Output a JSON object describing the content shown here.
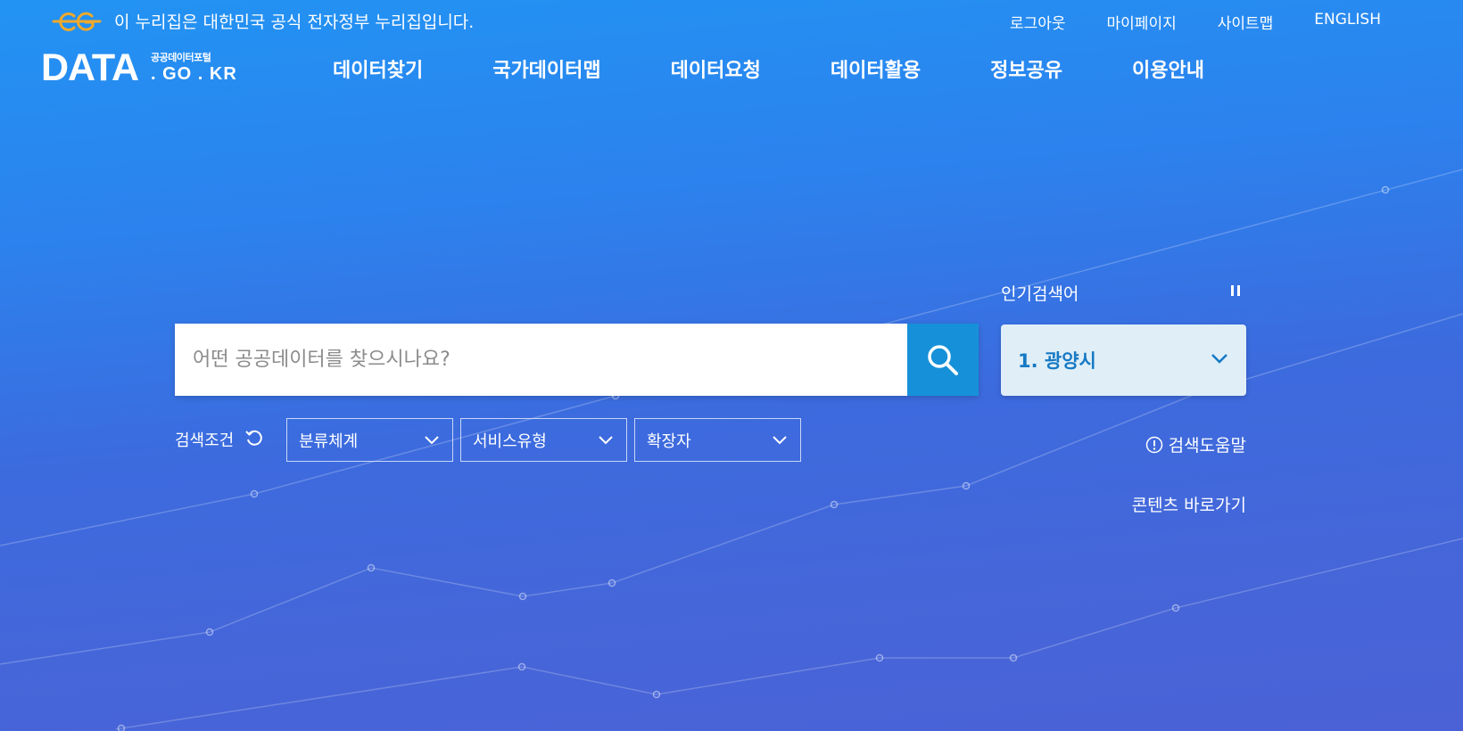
{
  "topbar": {
    "notice": "이 누리집은 대한민국 공식 전자정부 누리집입니다.",
    "links": [
      "로그아웃",
      "마이페이지",
      "사이트맵",
      "ENGLISH"
    ]
  },
  "logo": {
    "main": "DATA",
    "sub_korean": "공공데이터포털",
    "sub_domain": ". GO . KR"
  },
  "nav": {
    "items": [
      "데이터찾기",
      "국가데이터맵",
      "데이터요청",
      "데이터활용",
      "정보공유",
      "이용안내"
    ]
  },
  "search": {
    "placeholder": "어떤 공공데이터를 찾으시나요?",
    "value": "",
    "button_icon": "search-icon"
  },
  "popular": {
    "title": "인기검색어",
    "selected": "1. 광양시",
    "pause_icon": "pause-icon"
  },
  "filters": {
    "label": "검색조건",
    "reset_icon": "refresh-icon",
    "items": [
      "분류체계",
      "서비스유형",
      "확장자"
    ]
  },
  "help": {
    "label": "검색도움말",
    "icon": "info-circle-icon"
  },
  "content_link": "콘텐츠 바로가기",
  "colors": {
    "bg_top": "#2293f3",
    "bg_bottom": "#4a62d6",
    "search_button": "#1691d9",
    "popular_bg": "#dfeef7",
    "popular_text": "#1679c4",
    "eg_logo": "#f0a92b"
  }
}
